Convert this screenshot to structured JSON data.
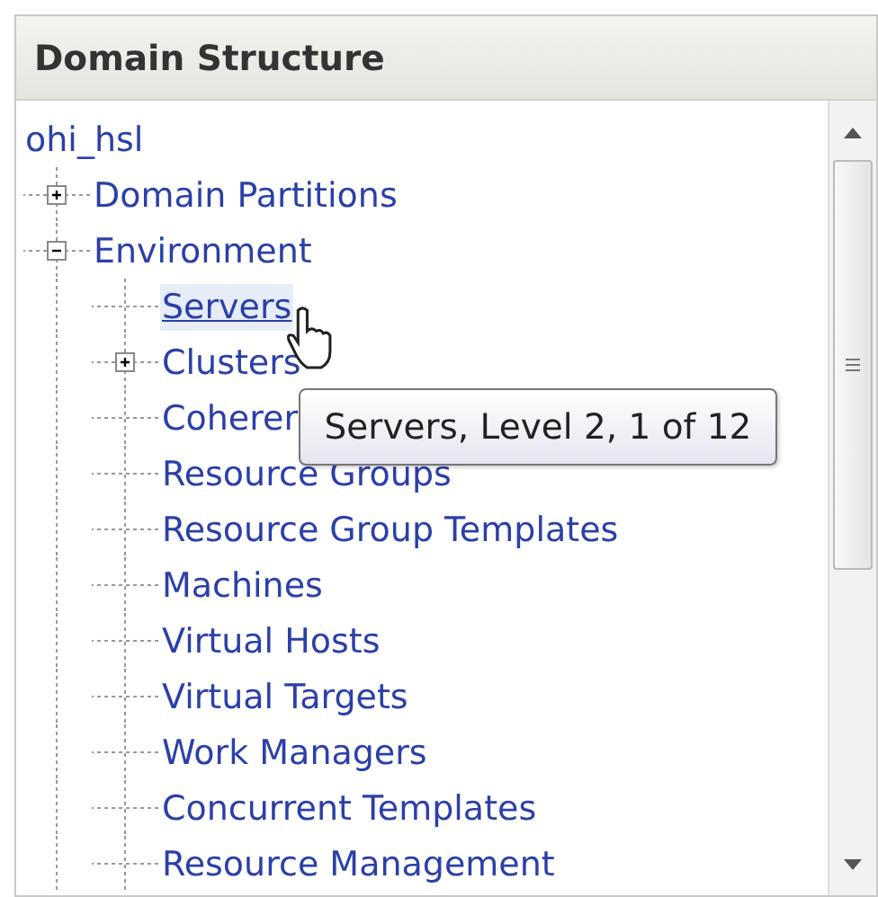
{
  "panel": {
    "title": "Domain Structure"
  },
  "tree": [
    {
      "label": "ohi_hsl",
      "children": [
        {
          "label": "Domain Partitions",
          "expanded": false
        },
        {
          "label": "Environment",
          "expanded": true,
          "children": [
            {
              "label": "Servers",
              "selected": true
            },
            {
              "label": "Clusters",
              "expanded": false,
              "selected": false
            },
            {
              "label": "Coherer",
              "selected": false
            },
            {
              "label": "Resource Groups",
              "selected": false
            },
            {
              "label": "Resource Group Templates",
              "selected": false
            },
            {
              "label": "Machines",
              "selected": false
            },
            {
              "label": "Virtual Hosts",
              "selected": false
            },
            {
              "label": "Virtual Targets",
              "selected": false
            },
            {
              "label": "Work Managers",
              "selected": false
            },
            {
              "label": "Concurrent Templates",
              "selected": false
            },
            {
              "label": "Resource Management",
              "selected": false
            }
          ]
        }
      ]
    }
  ],
  "tooltip": "Servers, Level 2, 1 of 12"
}
